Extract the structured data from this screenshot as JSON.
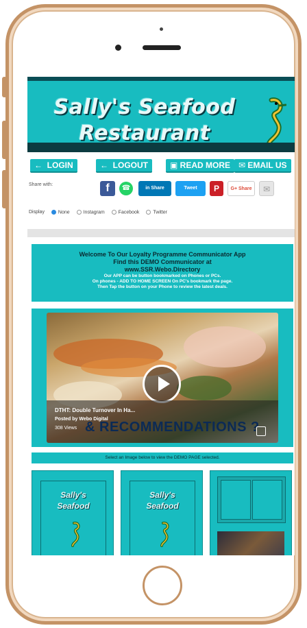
{
  "header": {
    "title_line1": "Sally's Seafood",
    "title_line2": "Restaurant",
    "accent_color": "#18bcc0"
  },
  "nav": {
    "login": "LOGIN",
    "logout": "LOGOUT",
    "read_more": "READ MORE",
    "email_us": "EMAIL US"
  },
  "share": {
    "label": "Share with:",
    "facebook": "f",
    "linkedin": "in Share",
    "twitter": "Tweet",
    "pinterest": "P",
    "google": "G+ Share"
  },
  "display": {
    "label": "Display",
    "options": [
      "None",
      "Instagram",
      "Facebook",
      "Twitter"
    ],
    "selected": "None"
  },
  "welcome": {
    "line1": "Welcome To Our Loyalty Programme Communicator App",
    "line2": "Find this DEMO Communicator at",
    "line3": "www.SSR.Webo.Directory",
    "line4": "Our APP can be button bookmarked on Phones or PCs.",
    "line5": "On phones - ADD TO HOME SCREEN     On PC's bookmark the page.",
    "line6": "Then Tap the button on your Phone to review the latest deals."
  },
  "video": {
    "title": "DTHT: Double Turnover In Ha...",
    "posted": "Posted by Webo Digital",
    "views": "308 Views",
    "overlay_text": "& RECOMMENDATIONS ?"
  },
  "select_bar": {
    "text": "Select an Image below to view the DEMO PAGE selected."
  },
  "tiles": [
    {
      "line1": "Sally's",
      "line2": "Seafood"
    },
    {
      "line1": "Sally's",
      "line2": "Seafood"
    },
    {
      "line1": "",
      "line2": ""
    }
  ]
}
